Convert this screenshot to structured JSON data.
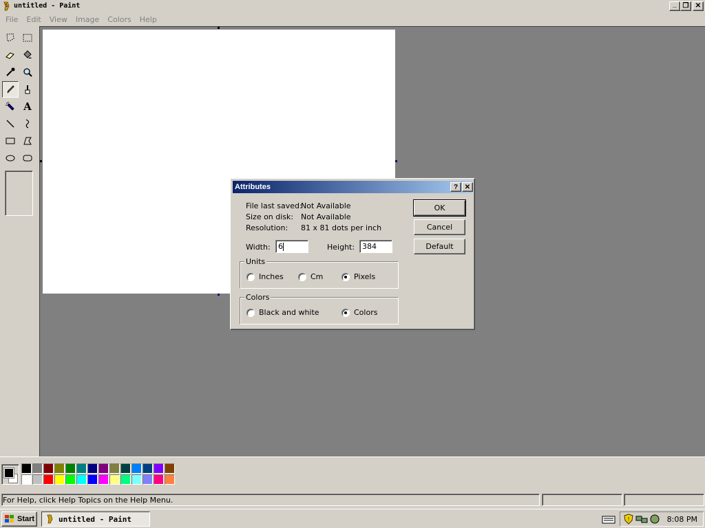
{
  "window": {
    "title": "untitled - Paint",
    "controls": {
      "minimize": "_",
      "restore": "❐",
      "close": "✕"
    }
  },
  "menu": [
    "File",
    "Edit",
    "View",
    "Image",
    "Colors",
    "Help"
  ],
  "toolbox": {
    "tools": [
      {
        "name": "free-form-select",
        "icon": "free-select-icon"
      },
      {
        "name": "select",
        "icon": "rect-select-icon"
      },
      {
        "name": "eraser",
        "icon": "eraser-icon"
      },
      {
        "name": "fill-with-color",
        "icon": "fill-bucket-icon"
      },
      {
        "name": "pick-color",
        "icon": "eyedropper-icon"
      },
      {
        "name": "magnifier",
        "icon": "magnifier-icon"
      },
      {
        "name": "pencil",
        "icon": "pencil-icon",
        "active": true
      },
      {
        "name": "brush",
        "icon": "brush-icon"
      },
      {
        "name": "airbrush",
        "icon": "airbrush-icon"
      },
      {
        "name": "text",
        "icon": "text-icon",
        "glyph": "A"
      },
      {
        "name": "line",
        "icon": "line-icon"
      },
      {
        "name": "curve",
        "icon": "curve-icon"
      },
      {
        "name": "rectangle",
        "icon": "rectangle-icon"
      },
      {
        "name": "polygon",
        "icon": "polygon-icon"
      },
      {
        "name": "ellipse",
        "icon": "ellipse-icon"
      },
      {
        "name": "rounded-rectangle",
        "icon": "rounded-rect-icon"
      }
    ]
  },
  "palette": {
    "foreground": "#000000",
    "background": "#ffffff",
    "row1": [
      "#000000",
      "#808080",
      "#800000",
      "#808000",
      "#008000",
      "#008080",
      "#000080",
      "#800080",
      "#808040",
      "#004040",
      "#0080ff",
      "#004080",
      "#8000ff",
      "#804000"
    ],
    "row2": [
      "#ffffff",
      "#c0c0c0",
      "#ff0000",
      "#ffff00",
      "#00ff00",
      "#00ffff",
      "#0000ff",
      "#ff00ff",
      "#ffff80",
      "#00ff80",
      "#80ffff",
      "#8080ff",
      "#ff0080",
      "#ff8040"
    ]
  },
  "status": {
    "help_text": "For Help, click Help Topics on the Help Menu."
  },
  "dialog": {
    "title": "Attributes",
    "help_btn": "?",
    "close_btn": "✕",
    "file_last_saved_label": "File last saved:",
    "file_last_saved_value": "Not Available",
    "size_on_disk_label": "Size on disk:",
    "size_on_disk_value": "Not Available",
    "resolution_label": "Resolution:",
    "resolution_value": "81 x 81 dots per inch",
    "width_label": "Width:",
    "width_value": "6",
    "height_label": "Height:",
    "height_value": "384",
    "units": {
      "label": "Units",
      "options": [
        "Inches",
        "Cm",
        "Pixels"
      ],
      "selected": "Pixels"
    },
    "colors": {
      "label": "Colors",
      "options": [
        "Black and white",
        "Colors"
      ],
      "selected": "Colors"
    },
    "buttons": {
      "ok": "OK",
      "cancel": "Cancel",
      "default": "Default"
    }
  },
  "taskbar": {
    "start": "Start",
    "task_title": "untitled - Paint",
    "clock": "8:08 PM"
  }
}
